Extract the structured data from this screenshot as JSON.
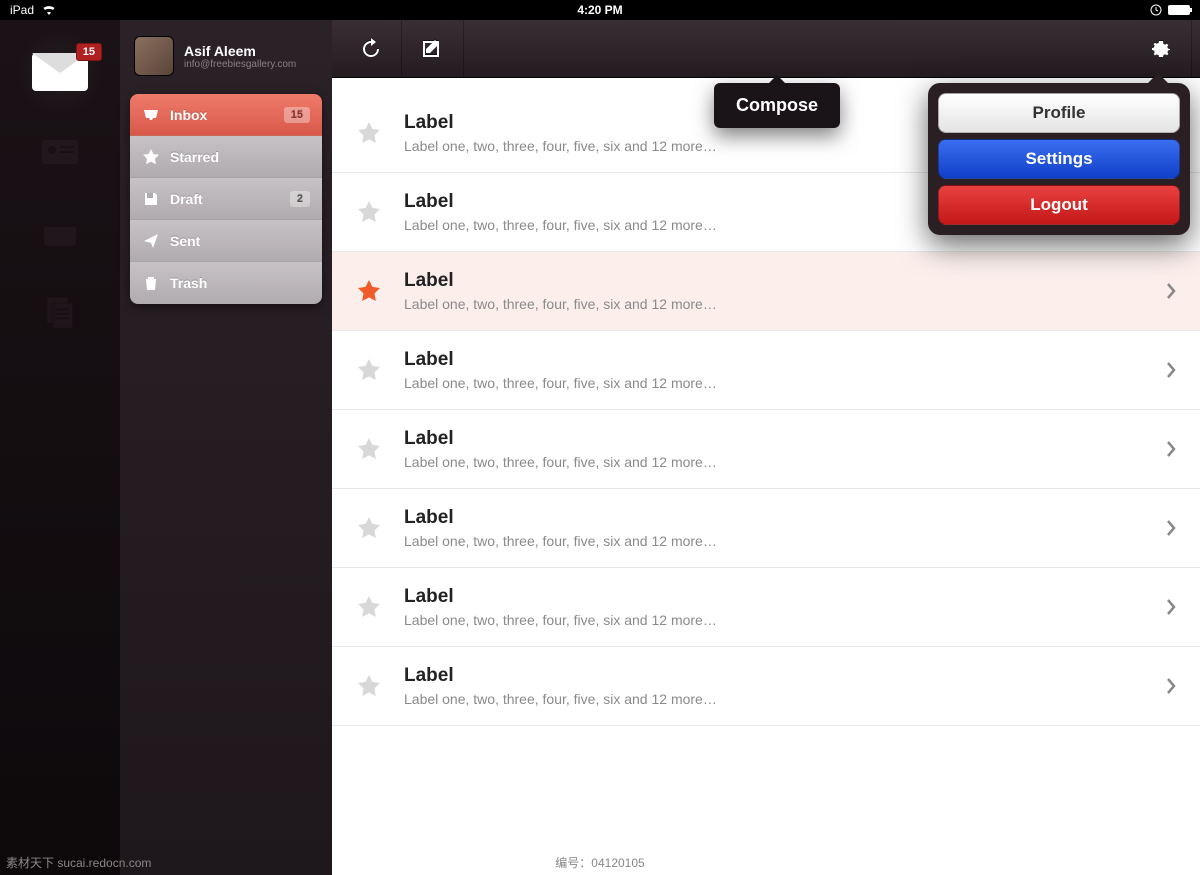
{
  "statusbar": {
    "device": "iPad",
    "time": "4:20 PM"
  },
  "rail": {
    "mail_badge": "15"
  },
  "profile": {
    "name": "Asif Aleem",
    "email": "info@freebiesgallery.com"
  },
  "folders": [
    {
      "label": "Inbox",
      "badge": "15",
      "active": true
    },
    {
      "label": "Starred"
    },
    {
      "label": "Draft",
      "badge": "2"
    },
    {
      "label": "Sent"
    },
    {
      "label": "Trash"
    }
  ],
  "tooltip": {
    "text": "Compose"
  },
  "popover": {
    "profile": "Profile",
    "settings": "Settings",
    "logout": "Logout"
  },
  "messages": [
    {
      "title": "Label",
      "sub": "Label one, two, three, four, five, six and 12 more…",
      "starred": false
    },
    {
      "title": "Label",
      "sub": "Label one, two, three, four, five, six and 12 more…",
      "starred": false
    },
    {
      "title": "Label",
      "sub": "Label one, two, three, four, five, six and 12 more…",
      "starred": true
    },
    {
      "title": "Label",
      "sub": "Label one, two, three, four, five, six and 12 more…",
      "starred": false
    },
    {
      "title": "Label",
      "sub": "Label one, two, three, four, five, six and 12 more…",
      "starred": false
    },
    {
      "title": "Label",
      "sub": "Label one, two, three, four, five, six and 12 more…",
      "starred": false
    },
    {
      "title": "Label",
      "sub": "Label one, two, three, four, five, six and 12 more…",
      "starred": false
    },
    {
      "title": "Label",
      "sub": "Label one, two, three, four, five, six and 12 more…",
      "starred": false
    }
  ],
  "watermark": {
    "left": "素材天下 sucai.redocn.com",
    "center": "编号：04120105"
  }
}
